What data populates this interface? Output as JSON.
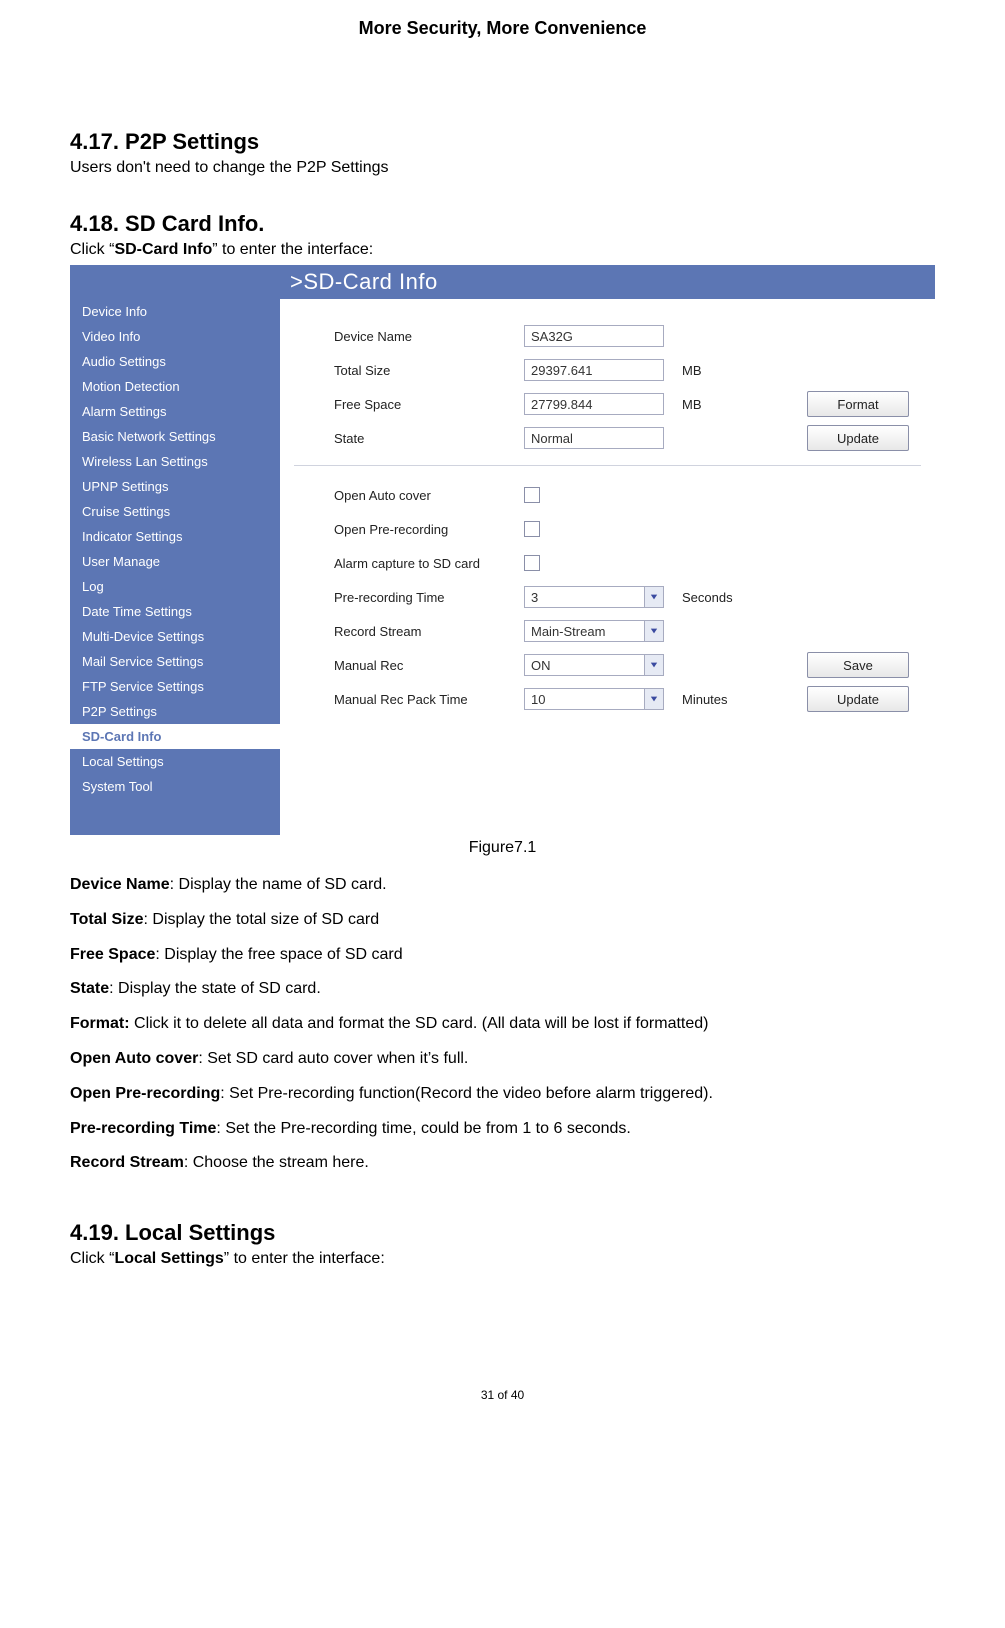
{
  "header": "More Security, More Convenience",
  "sections": {
    "s417": {
      "heading": "4.17. P2P Settings",
      "intro": "Users don't need to change the P2P Settings"
    },
    "s418": {
      "heading": "4.18. SD Card Info.",
      "intro_prefix": "Click “",
      "intro_bold": "SD-Card Info",
      "intro_suffix": "” to enter the interface:"
    },
    "s419": {
      "heading": "4.19. Local Settings",
      "intro_prefix": "Click “",
      "intro_bold": "Local Settings",
      "intro_suffix": "” to enter the interface:"
    }
  },
  "shot": {
    "title": ">SD-Card Info",
    "sidebar": {
      "items": [
        "Device Info",
        "Video Info",
        "Audio Settings",
        "Motion Detection",
        "Alarm Settings",
        "Basic Network Settings",
        "Wireless Lan Settings",
        "UPNP Settings",
        "Cruise Settings",
        "Indicator Settings",
        "User Manage",
        "Log",
        "Date Time Settings",
        "Multi-Device Settings",
        "Mail Service Settings",
        "FTP Service Settings",
        "P2P Settings",
        "SD-Card Info",
        "Local Settings",
        "System Tool"
      ],
      "active_index": 17
    },
    "top_block": {
      "device_name_label": "Device Name",
      "device_name_value": "SA32G",
      "total_size_label": "Total Size",
      "total_size_value": "29397.641",
      "free_space_label": "Free Space",
      "free_space_value": "27799.844",
      "state_label": "State",
      "state_value": "Normal",
      "mb": "MB"
    },
    "bottom_block": {
      "auto_cover_label": "Open Auto cover",
      "pre_rec_label": "Open Pre-recording",
      "alarm_cap_label": "Alarm capture to SD card",
      "pre_time_label": "Pre-recording Time",
      "pre_time_value": "3",
      "pre_time_unit": "Seconds",
      "rec_stream_label": "Record Stream",
      "rec_stream_value": "Main-Stream",
      "manual_rec_label": "Manual Rec",
      "manual_rec_value": "ON",
      "pack_time_label": "Manual Rec Pack Time",
      "pack_time_value": "10",
      "pack_time_unit": "Minutes"
    },
    "buttons": {
      "format": "Format",
      "update1": "Update",
      "save": "Save",
      "update2": "Update"
    }
  },
  "figure_caption": "Figure7.1",
  "defs": [
    {
      "term": "Device Name",
      "sep": ": ",
      "text": "Display the name of SD card."
    },
    {
      "term": "Total Size",
      "sep": ": ",
      "text": "Display the total size of SD card"
    },
    {
      "term": "Free Space",
      "sep": ": ",
      "text": "Display the free space of SD card"
    },
    {
      "term": "State",
      "sep": ": ",
      "text": "Display the state of SD card."
    },
    {
      "term": "Format:",
      "sep": " ",
      "text": "Click it to delete all data and format the SD card. (All data will be lost if formatted)"
    },
    {
      "term": "Open Auto cover",
      "sep": ": ",
      "text": "Set SD card auto cover when it’s full."
    },
    {
      "term": "Open Pre-recording",
      "sep": ": ",
      "text": "Set Pre-recording function(Record the video before alarm triggered)."
    },
    {
      "term": "Pre-recording Time",
      "sep": ": ",
      "text": "Set the Pre-recording time, could be from 1 to 6 seconds."
    },
    {
      "term": "Record Stream",
      "sep": ": ",
      "text": "Choose the stream here."
    }
  ],
  "page_number": "31 of 40"
}
